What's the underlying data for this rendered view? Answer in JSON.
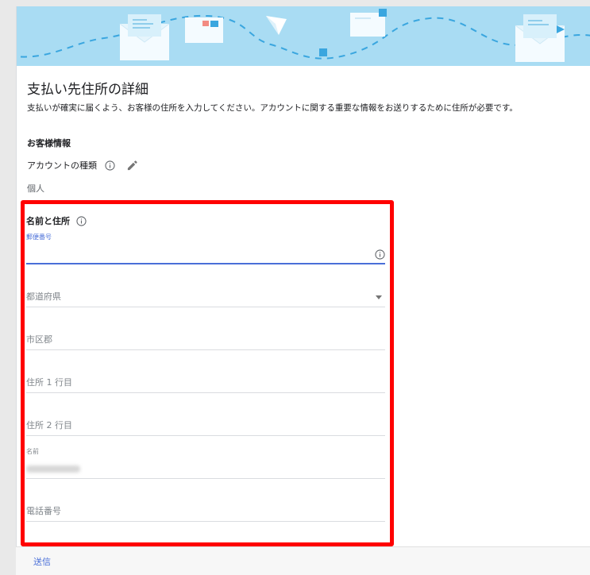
{
  "page": {
    "title": "支払い先住所の詳細",
    "subtitle": "支払いが確実に届くよう、お客様の住所を入力してください。アカウントに関する重要な情報をお送りするために住所が必要です。"
  },
  "customer_info": {
    "heading": "お客様情報",
    "account_type_label": "アカウントの種類",
    "account_type_value": "個人"
  },
  "address_form": {
    "heading": "名前と住所",
    "fields": {
      "postal_code": {
        "label": "郵便番号",
        "value": ""
      },
      "prefecture": {
        "placeholder": "都道府県"
      },
      "city": {
        "placeholder": "市区郡"
      },
      "address_line1": {
        "placeholder": "住所 1 行目"
      },
      "address_line2": {
        "placeholder": "住所 2 行目"
      },
      "name": {
        "label": "名前"
      },
      "phone": {
        "placeholder": "電話番号"
      }
    }
  },
  "footer": {
    "submit_label": "送信"
  },
  "colors": {
    "banner": "#a9dcf3",
    "accent_blue": "#4a6fd8",
    "highlight_red": "#ff0000"
  },
  "icons": {
    "info": "info-icon",
    "edit": "pencil-icon",
    "dropdown": "caret-down-icon"
  }
}
